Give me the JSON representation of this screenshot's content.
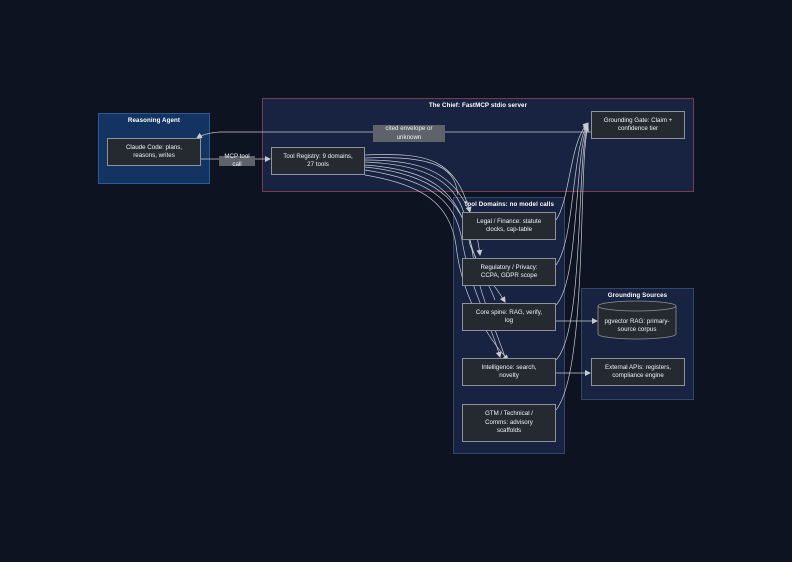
{
  "clusters": {
    "reasoning_agent": "Reasoning Agent",
    "chief": "The Chief: FastMCP stdio server",
    "tool_domains": "Tool Domains: no model calls",
    "grounding_sources": "Grounding Sources"
  },
  "nodes": {
    "claude_code": "Claude Code: plans,\nreasons, writes",
    "tool_registry": "Tool Registry: 9 domains,\n27 tools",
    "grounding_gate": "Grounding Gate: Claim +\nconfidence tier",
    "legal_finance": "Legal / Finance: statute\nclocks, cap-table",
    "regulatory_privacy": "Regulatory / Privacy:\nCCPA, GDPR scope",
    "core_spine": "Core spine: RAG, verify,\nlog",
    "intelligence": "Intelligence: search,\nnovelty",
    "gtm": "GTM / Technical /\nComms: advisory\nscaffolds",
    "pgvector": "pgvector RAG: primary-\nsource corpus",
    "external_apis": "External APIs: registers,\ncompliance engine"
  },
  "edge_labels": {
    "mcp_tool_call": "MCP tool call",
    "cited_envelope": "cited envelope or\nunknown"
  },
  "colors": {
    "background": "#0d1320",
    "reasoning_agent_fill": "#133461",
    "reasoning_agent_border": "#2a5a9a",
    "chief_fill": "#172341",
    "chief_border": "#7a3a52",
    "domains_fill": "#172341",
    "domains_border": "#34466a",
    "node_fill": "#252a30",
    "node_border": "#8d939a",
    "edge": "#c8ccd2",
    "edge_label_fill": "#5e636a"
  }
}
